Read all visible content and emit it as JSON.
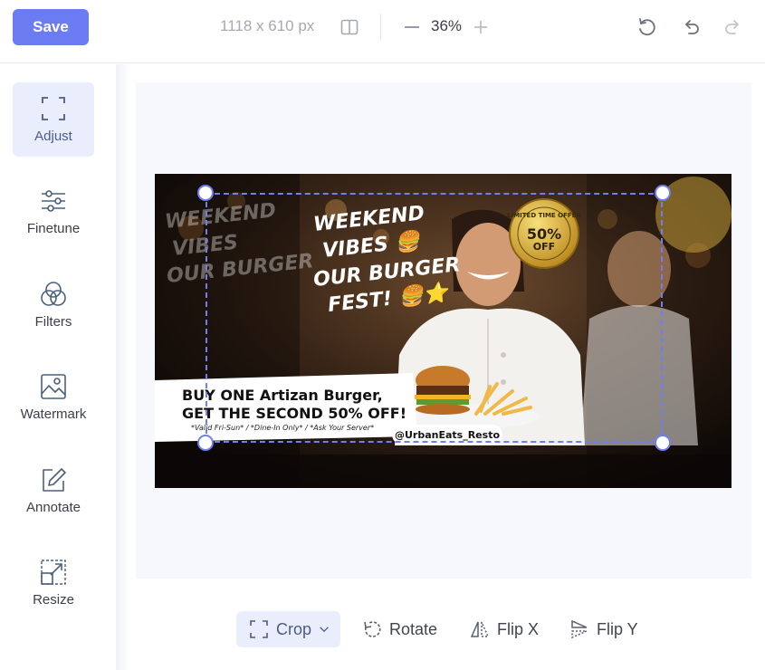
{
  "toolbar": {
    "save_label": "Save",
    "dimensions": "1118 x 610 px",
    "zoom": "36%"
  },
  "sidebar": {
    "items": [
      {
        "label": "Adjust",
        "icon": "crop-frame-icon",
        "active": true
      },
      {
        "label": "Finetune",
        "icon": "sliders-icon",
        "active": false
      },
      {
        "label": "Filters",
        "icon": "color-circles-icon",
        "active": false
      },
      {
        "label": "Watermark",
        "icon": "image-icon",
        "active": false
      },
      {
        "label": "Annotate",
        "icon": "pen-square-icon",
        "active": false
      },
      {
        "label": "Resize",
        "icon": "resize-icon",
        "active": false
      }
    ]
  },
  "bottom_tools": [
    {
      "label": "Crop",
      "icon": "crop-icon",
      "active": true
    },
    {
      "label": "Rotate",
      "icon": "rotate-icon",
      "active": false
    },
    {
      "label": "Flip X",
      "icon": "flip-x-icon",
      "active": false
    },
    {
      "label": "Flip Y",
      "icon": "flip-y-icon",
      "active": false
    }
  ],
  "image": {
    "headline": [
      "WEEKEND",
      "VIBES 🍔",
      "OUR BURGER",
      "FEST! 🍔⭐"
    ],
    "badge": [
      "LIMITED TIME OFFER",
      "50%",
      "OFF"
    ],
    "offer_line1": "BUY ONE Artizan Burger,",
    "offer_line2": "GET THE SECOND 50% OFF!",
    "offer_note": "*Valid Fri-Sun* / *Dine-In Only* / *Ask Your Server*",
    "handle": "@UrbanEats_Resto",
    "colors": {
      "accent": "#6b7cf2",
      "badge_gold": "#d9b23a",
      "bg_dark": "#1a1310"
    }
  }
}
